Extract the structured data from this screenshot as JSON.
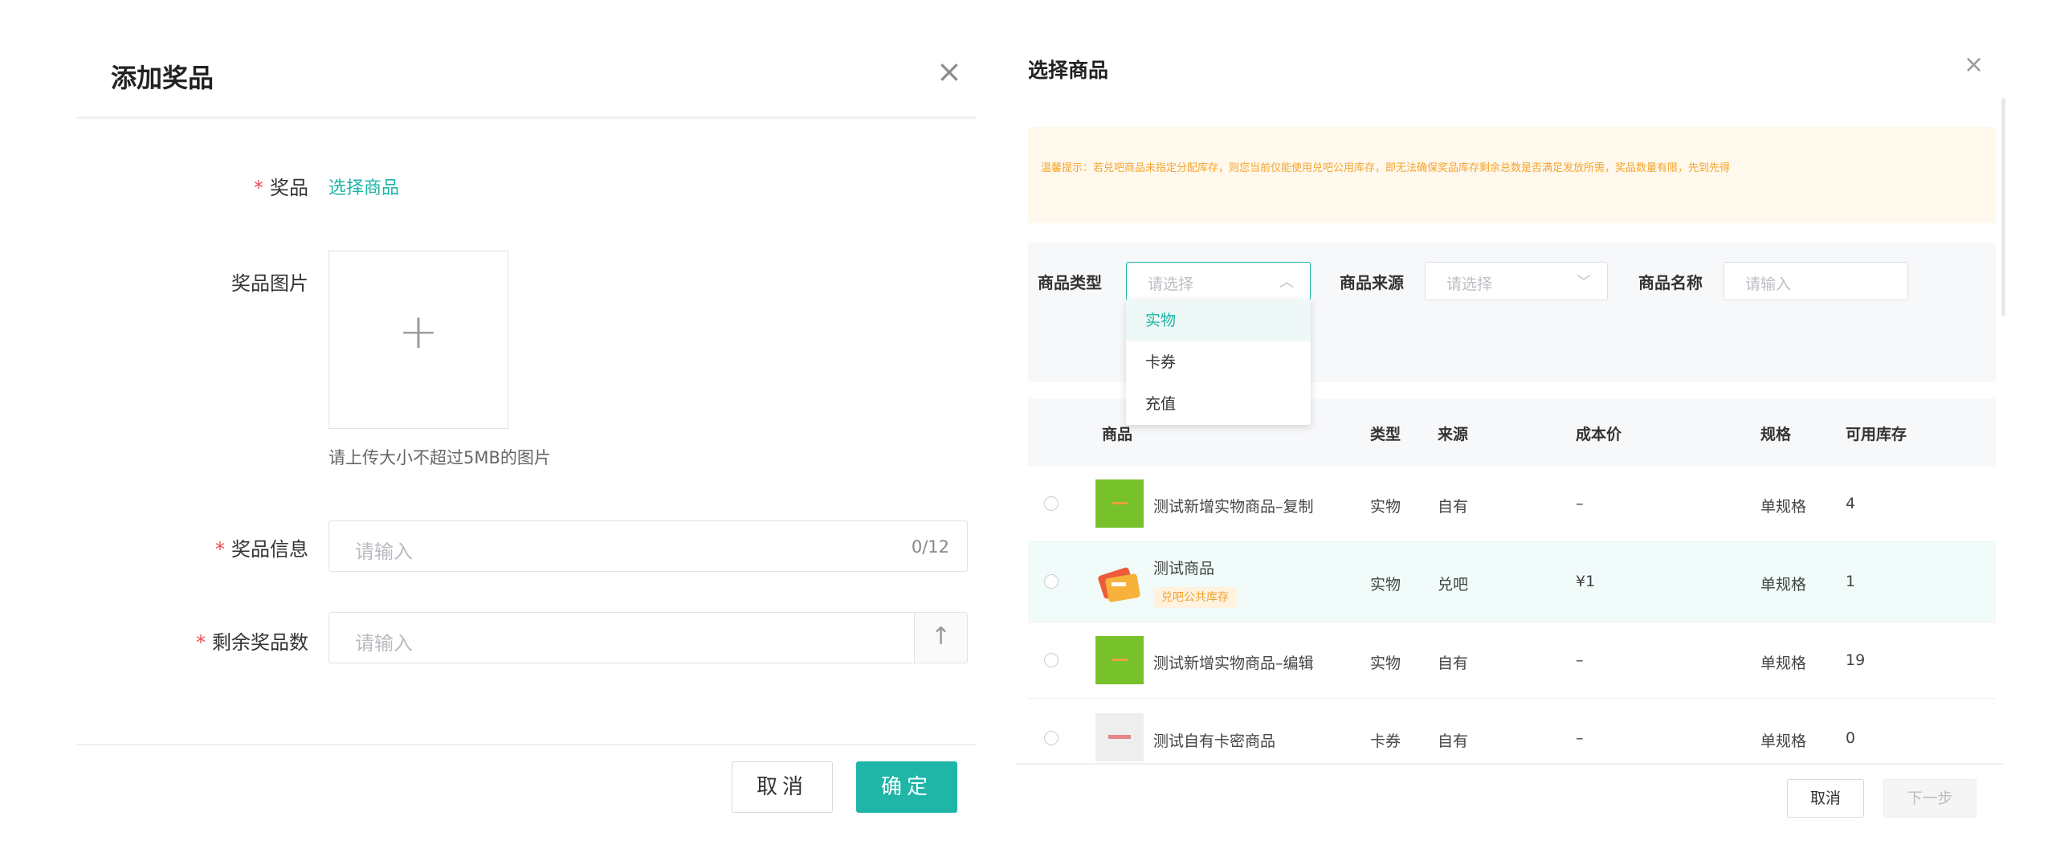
{
  "add_prize": {
    "title": "添加奖品",
    "close_glyph": "×",
    "prize": {
      "required": "*",
      "label": "奖品",
      "select_link": "选择商品"
    },
    "image": {
      "label": "奖品图片",
      "plus_glyph": "+",
      "hint": "请上传大小不超过5MB的图片"
    },
    "info": {
      "required": "*",
      "label": "奖品信息",
      "placeholder": "请输入",
      "counter": "0/12"
    },
    "remaining": {
      "required": "*",
      "label": "剩余奖品数",
      "placeholder": "请输入",
      "stepper_glyph": "↑"
    },
    "footer": {
      "cancel_label": "取消",
      "confirm_label": "确定"
    },
    "accent_color": "#1fb5a7"
  },
  "select_goods": {
    "title": "选择商品",
    "close_glyph": "×",
    "notice": "温馨提示：若兑吧商品未指定分配库存，则您当前仅能使用兑吧公用库存，即无法确保奖品库存剩余总数是否满足发放所需，奖品数量有限，先到先得",
    "notice_color": "#f5a52c",
    "filters": {
      "type": {
        "label": "商品类型",
        "placeholder": "请选择",
        "arrow_glyph": "︿"
      },
      "source": {
        "label": "商品来源",
        "placeholder": "请选择",
        "arrow_glyph": "﹀"
      },
      "name": {
        "label": "商品名称",
        "placeholder": "请输入"
      }
    },
    "type_options": [
      "实物",
      "卡券",
      "充值"
    ],
    "columns": {
      "goods": "商品",
      "type": "类型",
      "source": "来源",
      "cost": "成本价",
      "spec": "规格",
      "stock": "可用库存"
    },
    "rows": [
      {
        "name": "测试新增实物商品–复制",
        "type": "实物",
        "source": "自有",
        "cost": "–",
        "spec": "单规格",
        "stock": "4"
      },
      {
        "name": "测试商品",
        "tag": "兑吧公共库存",
        "type": "实物",
        "source": "兑吧",
        "cost": "¥1",
        "spec": "单规格",
        "stock": "1"
      },
      {
        "name": "测试新增实物商品–编辑",
        "type": "实物",
        "source": "自有",
        "cost": "–",
        "spec": "单规格",
        "stock": "19"
      },
      {
        "name": "测试自有卡密商品",
        "type": "卡券",
        "source": "自有",
        "cost": "–",
        "spec": "单规格",
        "stock": "0"
      }
    ],
    "footer": {
      "cancel_label": "取消",
      "next_label": "下一步"
    }
  }
}
